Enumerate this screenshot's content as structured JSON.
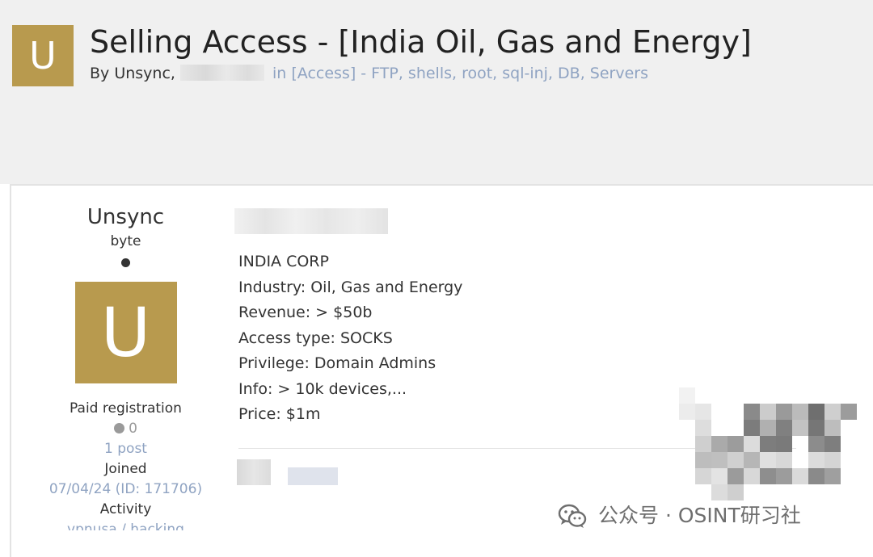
{
  "header": {
    "avatar_letter": "U",
    "title": "Selling Access - [India Oil, Gas and Energy]",
    "by_label": "By Unsync,",
    "in_label": "in",
    "forum": "[Access] - FTP, shells, root, sql-inj, DB, Servers"
  },
  "author": {
    "name": "Unsync",
    "rank": "byte",
    "avatar_letter": "U",
    "group": "Paid registration",
    "reputation": "0",
    "posts": "1 post",
    "joined_label": "Joined",
    "joined_value": "07/04/24 (ID: 171706)",
    "activity_label": "Activity",
    "activity_value": "vpnusa / hacking"
  },
  "post": {
    "lines": [
      "INDIA CORP",
      "Industry: Oil, Gas and Energy",
      "Revenue: > $50b",
      "Access type: SOCKS",
      "Privilege: Domain Admins",
      "Info: > 10k devices,...",
      "Price: $1m"
    ]
  },
  "watermark": {
    "text": "公众号 · OSINT研习社",
    "icon": "wechat-icon"
  },
  "colors": {
    "avatar_gold": "#b89a4e",
    "link_blue": "#8fa3c2",
    "text_dark": "#333333",
    "header_bg": "#f0f0f0"
  }
}
